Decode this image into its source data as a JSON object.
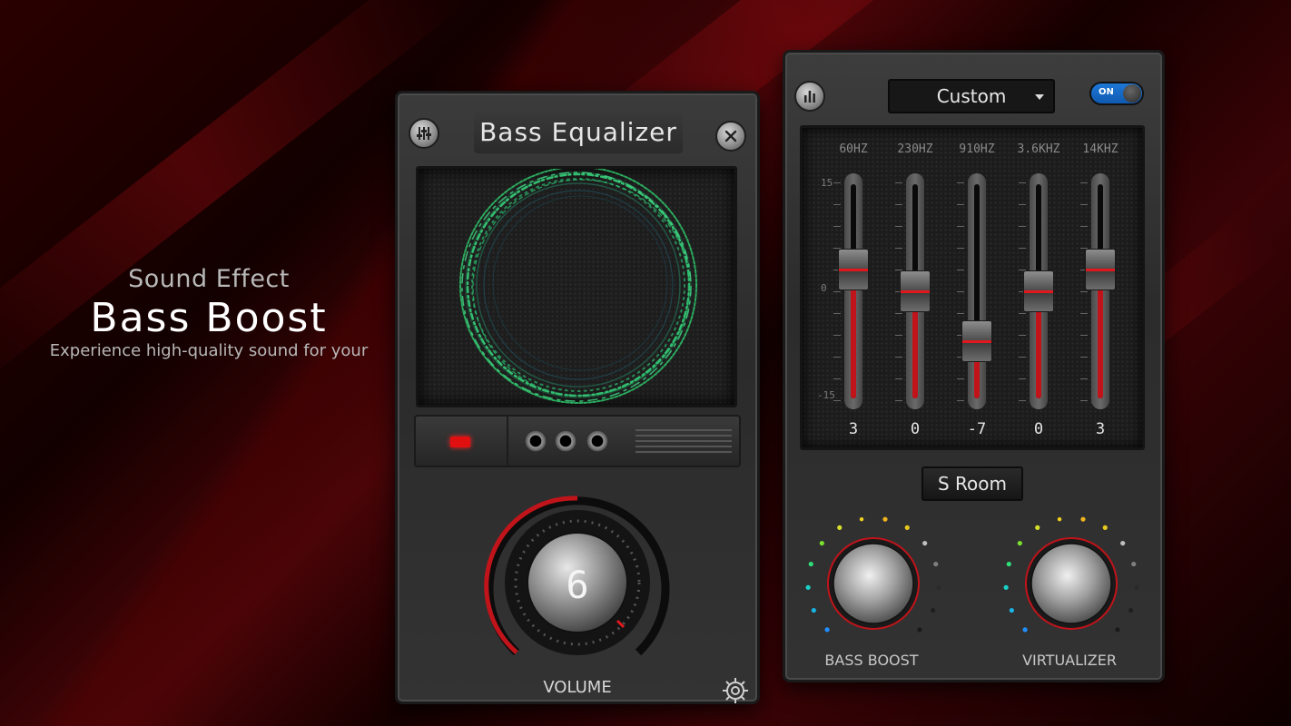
{
  "promo": {
    "subtitle": "Sound Effect",
    "title": "Bass Boost",
    "description": "Experience high-quality sound for your"
  },
  "left_panel": {
    "title": "Bass  Equalizer",
    "volume_value": "6",
    "volume_label": "VOLUME",
    "icons": [
      "sliders-icon",
      "close-icon",
      "settings-icon"
    ]
  },
  "right_panel": {
    "preset": "Custom",
    "power_toggle": "ON",
    "db_labels": {
      "top": "15",
      "mid": "0",
      "bottom": "-15"
    },
    "bands": [
      {
        "freq": "60HZ",
        "value": "3",
        "level": 3
      },
      {
        "freq": "230HZ",
        "value": "0",
        "level": 0
      },
      {
        "freq": "910HZ",
        "value": "-7",
        "level": -7
      },
      {
        "freq": "3.6KHZ",
        "value": "0",
        "level": 0
      },
      {
        "freq": "14KHZ",
        "value": "3",
        "level": 3
      }
    ],
    "reverb_preset": "S Room",
    "bass_boost_label": "BASS BOOST",
    "virtualizer_label": "VIRTUALIZER"
  },
  "colors": {
    "accent_red": "#e0181e",
    "toggle_blue": "#1e78d8",
    "visualizer_green": "#2ec46a"
  }
}
